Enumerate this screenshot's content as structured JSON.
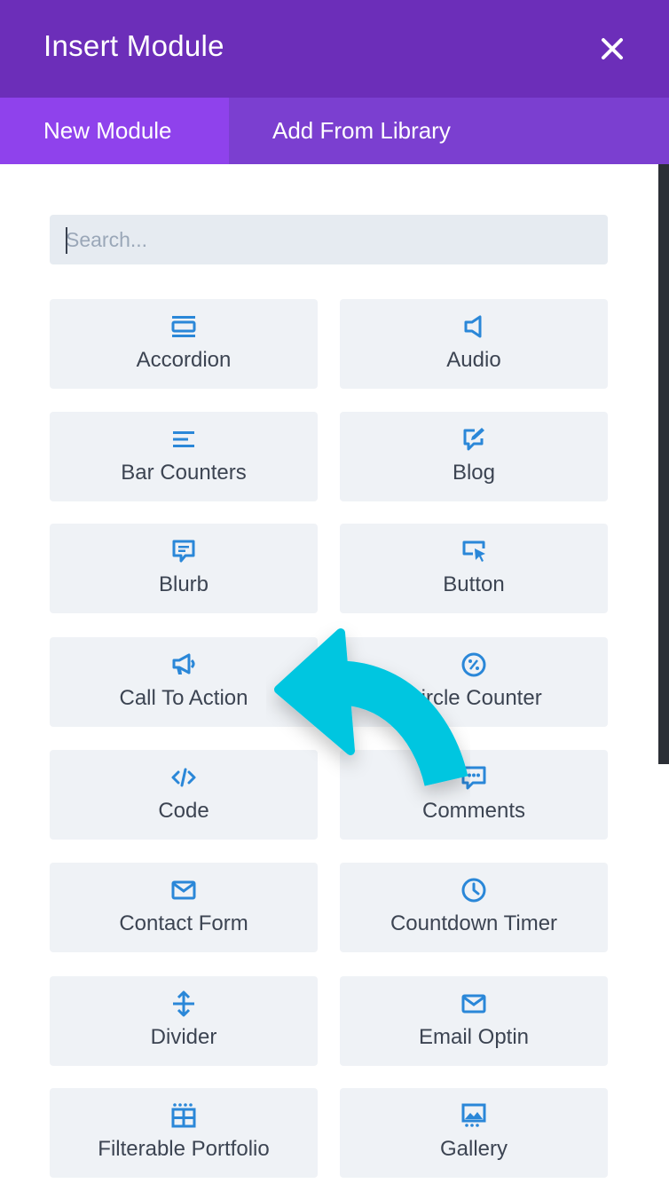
{
  "dialog": {
    "title": "Insert Module",
    "close_icon": "close-icon"
  },
  "tabs": [
    {
      "label": "New Module",
      "active": true
    },
    {
      "label": "Add From Library",
      "active": false
    }
  ],
  "search": {
    "placeholder": "Search...",
    "value": ""
  },
  "colors": {
    "header": "#6c2eb9",
    "tabs": "#7b3fd0",
    "active_tab": "#8f42ec",
    "icon": "#2a87d8",
    "arrow": "#00c6e0"
  },
  "modules": [
    {
      "label": "Accordion",
      "icon": "accordion-icon"
    },
    {
      "label": "Audio",
      "icon": "audio-icon"
    },
    {
      "label": "Bar Counters",
      "icon": "bar-counters-icon"
    },
    {
      "label": "Blog",
      "icon": "blog-icon"
    },
    {
      "label": "Blurb",
      "icon": "blurb-icon"
    },
    {
      "label": "Button",
      "icon": "button-icon"
    },
    {
      "label": "Call To Action",
      "icon": "call-to-action-icon"
    },
    {
      "label": "Circle Counter",
      "icon": "circle-counter-icon"
    },
    {
      "label": "Code",
      "icon": "code-icon"
    },
    {
      "label": "Comments",
      "icon": "comments-icon"
    },
    {
      "label": "Contact Form",
      "icon": "contact-form-icon"
    },
    {
      "label": "Countdown Timer",
      "icon": "countdown-timer-icon"
    },
    {
      "label": "Divider",
      "icon": "divider-icon"
    },
    {
      "label": "Email Optin",
      "icon": "email-optin-icon"
    },
    {
      "label": "Filterable Portfolio",
      "icon": "filterable-portfolio-icon"
    },
    {
      "label": "Gallery",
      "icon": "gallery-icon"
    }
  ],
  "overlay": {
    "arrow_icon": "curved-arrow-icon"
  }
}
